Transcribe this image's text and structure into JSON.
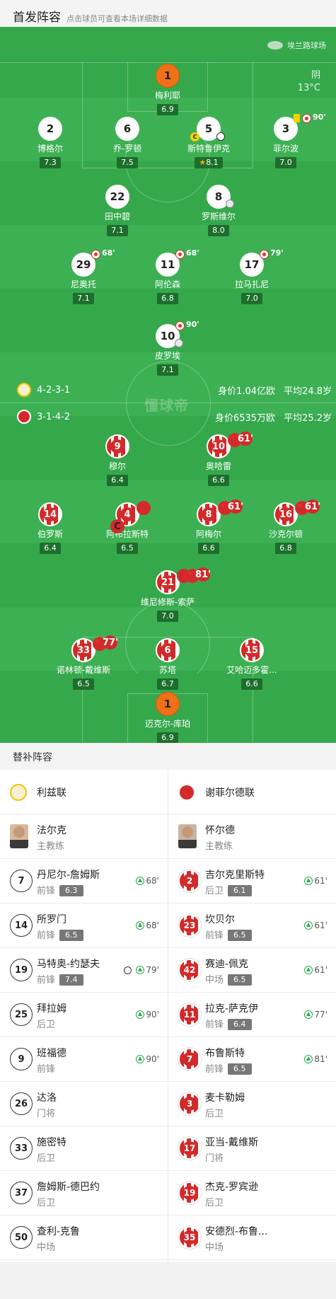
{
  "header": {
    "title": "首发阵容",
    "subtitle": "点击球员可查看本场详细数据"
  },
  "pitch": {
    "stadium": "埃兰路球场",
    "weather": "阴",
    "temperature": "13°C",
    "watermark": "懂球帝",
    "home_team": {
      "formation": "4-2-3-1",
      "value": "身价1.04亿欧",
      "avg_age": "平均24.8岁"
    },
    "away_team": {
      "formation": "3-1-4-2",
      "value": "身价6535万欧",
      "avg_age": "平均25.2岁"
    }
  },
  "home_players": [
    {
      "num": "1",
      "name": "梅利耶",
      "rating": "6.9"
    },
    {
      "num": "2",
      "name": "博格尔",
      "rating": "7.3"
    },
    {
      "num": "6",
      "name": "乔-罗顿",
      "rating": "7.5"
    },
    {
      "num": "5",
      "name": "斯特鲁伊克",
      "rating": "8.1"
    },
    {
      "num": "3",
      "name": "菲尔波",
      "rating": "7.0",
      "sub_min": "90'"
    },
    {
      "num": "22",
      "name": "田中碧",
      "rating": "7.1"
    },
    {
      "num": "8",
      "name": "罗斯维尔",
      "rating": "8.0"
    },
    {
      "num": "29",
      "name": "尼奥托",
      "rating": "7.1",
      "sub_min": "68'"
    },
    {
      "num": "11",
      "name": "阿伦森",
      "rating": "6.8",
      "sub_min": "68'"
    },
    {
      "num": "17",
      "name": "拉马扎尼",
      "rating": "7.0",
      "sub_min": "79'"
    },
    {
      "num": "10",
      "name": "皮罗埃",
      "rating": "7.1",
      "sub_min": "90'"
    }
  ],
  "away_players": [
    {
      "num": "9",
      "name": "穆尔",
      "rating": "6.4"
    },
    {
      "num": "10",
      "name": "奥哈雷",
      "rating": "6.6",
      "sub_min": "61'"
    },
    {
      "num": "14",
      "name": "伯罗斯",
      "rating": "6.4"
    },
    {
      "num": "4",
      "name": "阿布拉斯特",
      "rating": "6.5"
    },
    {
      "num": "8",
      "name": "阿梅尔",
      "rating": "6.6",
      "sub_min": "61'"
    },
    {
      "num": "16",
      "name": "沙克尔顿",
      "rating": "6.8",
      "sub_min": "61'"
    },
    {
      "num": "21",
      "name": "维尼修斯-索萨",
      "rating": "7.0",
      "sub_min": "81'"
    },
    {
      "num": "33",
      "name": "诺林顿-戴维斯",
      "rating": "6.5",
      "sub_min": "77'"
    },
    {
      "num": "6",
      "name": "苏塔",
      "rating": "6.7"
    },
    {
      "num": "15",
      "name": "艾哈迈多霍...",
      "rating": "6.6"
    },
    {
      "num": "1",
      "name": "迈克尔-库珀",
      "rating": "6.9"
    }
  ],
  "subs": {
    "title": "替补阵容",
    "home": {
      "team": "利兹联",
      "coach": {
        "name": "法尔克",
        "role": "主教练"
      },
      "players": [
        {
          "num": "7",
          "name": "丹尼尔-詹姆斯",
          "pos": "前锋",
          "rating": "6.3",
          "in": "68'"
        },
        {
          "num": "14",
          "name": "所罗门",
          "pos": "前锋",
          "rating": "6.5",
          "in": "68'"
        },
        {
          "num": "19",
          "name": "马特奥-约瑟夫",
          "pos": "前锋",
          "rating": "7.4",
          "in": "79'"
        },
        {
          "num": "25",
          "name": "拜拉姆",
          "pos": "后卫",
          "in": "90'"
        },
        {
          "num": "9",
          "name": "班福德",
          "pos": "前锋",
          "in": "90'"
        },
        {
          "num": "26",
          "name": "达洛",
          "pos": "门将"
        },
        {
          "num": "33",
          "name": "施密特",
          "pos": "后卫"
        },
        {
          "num": "37",
          "name": "詹姆斯-德巴约",
          "pos": "后卫"
        },
        {
          "num": "50",
          "name": "查利-克鲁",
          "pos": "中场"
        }
      ]
    },
    "away": {
      "team": "谢菲尔德联",
      "coach": {
        "name": "怀尔德",
        "role": "主教练"
      },
      "players": [
        {
          "num": "2",
          "name": "吉尔克里斯特",
          "pos": "后卫",
          "rating": "6.1",
          "in": "61'"
        },
        {
          "num": "23",
          "name": "坎贝尔",
          "pos": "前锋",
          "rating": "6.5",
          "in": "61'"
        },
        {
          "num": "42",
          "name": "赛迪-佩克",
          "pos": "中场",
          "rating": "6.5",
          "in": "61'"
        },
        {
          "num": "11",
          "name": "拉克-萨克伊",
          "pos": "前锋",
          "rating": "6.4",
          "in": "77'"
        },
        {
          "num": "7",
          "name": "布鲁斯特",
          "pos": "前锋",
          "rating": "6.5",
          "in": "81'"
        },
        {
          "num": "3",
          "name": "麦卡勒姆",
          "pos": "后卫"
        },
        {
          "num": "17",
          "name": "亚当-戴维斯",
          "pos": "门将"
        },
        {
          "num": "19",
          "name": "杰克-罗宾逊",
          "pos": "后卫"
        },
        {
          "num": "35",
          "name": "安德烈-布鲁...",
          "pos": "中场"
        }
      ]
    }
  },
  "colors": {
    "pitch": "#36a84c",
    "leeds_gk": "#f07018",
    "sheff_red": "#d22a2a",
    "rating_bg": "#1d6e2c"
  }
}
